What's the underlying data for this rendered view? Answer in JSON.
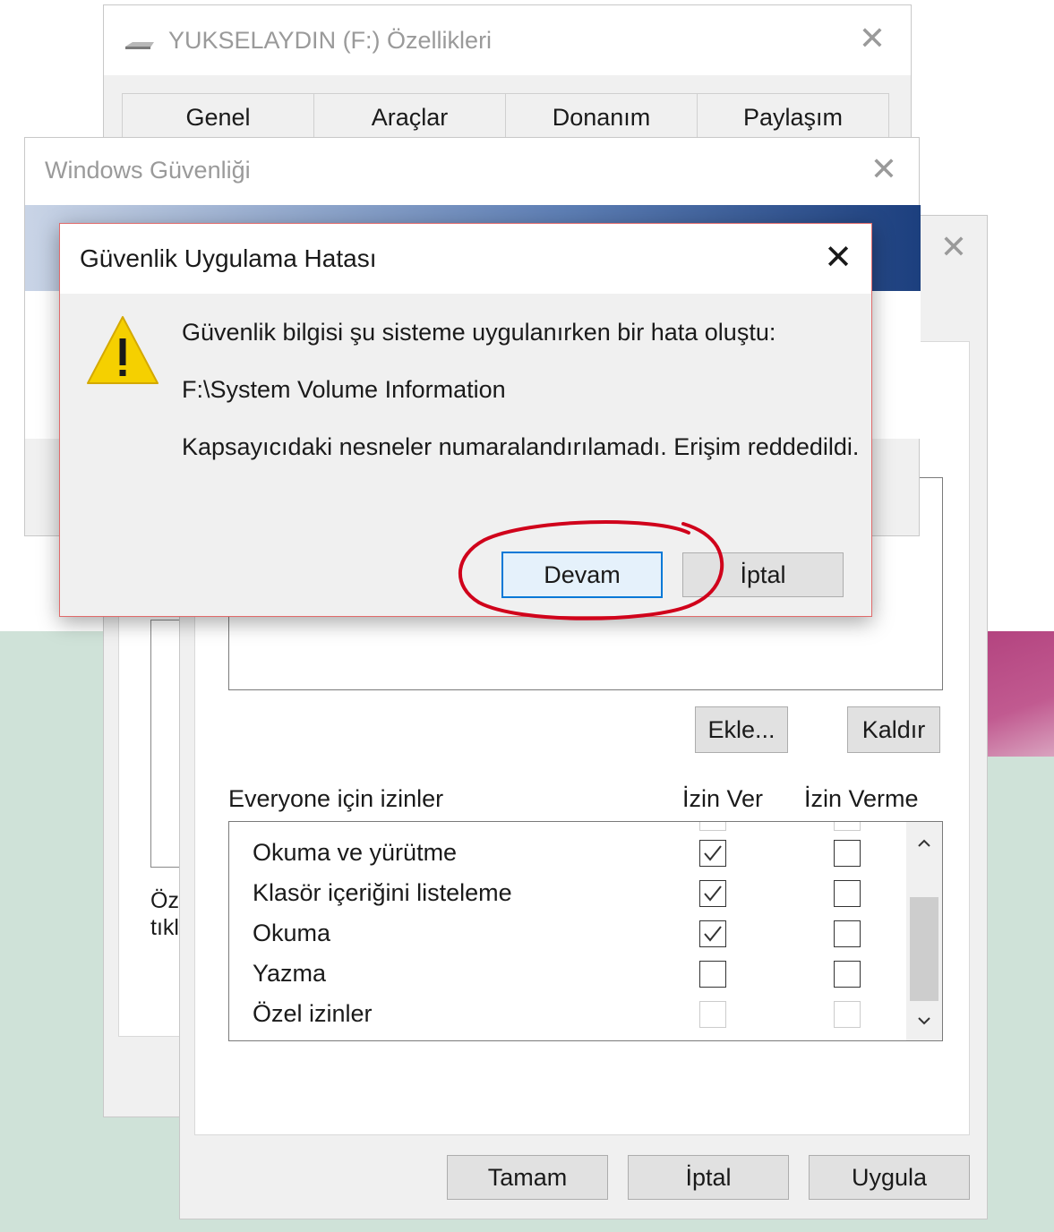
{
  "properties_window": {
    "title": "YUKSELAYDIN (F:) Özellikleri",
    "tabs": [
      "Genel",
      "Araçlar",
      "Donanım",
      "Paylaşım"
    ],
    "partial_text_line1": "Öz",
    "partial_text_line2": "tıkl"
  },
  "permissions_window": {
    "buttons": {
      "add": "Ekle...",
      "remove": "Kaldır",
      "ok": "Tamam",
      "cancel": "İptal",
      "apply": "Uygula"
    },
    "permissions_label": "Everyone için izinler",
    "allow_header": "İzin Ver",
    "deny_header": "İzin Verme",
    "permissions": [
      {
        "name": "Okuma ve yürütme",
        "allow": true,
        "deny": false,
        "disabled": false
      },
      {
        "name": "Klasör içeriğini listeleme",
        "allow": true,
        "deny": false,
        "disabled": false
      },
      {
        "name": "Okuma",
        "allow": true,
        "deny": false,
        "disabled": false
      },
      {
        "name": "Yazma",
        "allow": false,
        "deny": false,
        "disabled": false
      },
      {
        "name": "Özel izinler",
        "allow": false,
        "deny": false,
        "disabled": true
      }
    ]
  },
  "security_window": {
    "title": "Windows Güvenliği"
  },
  "error_dialog": {
    "title": "Güvenlik Uygulama Hatası",
    "message_line1": "Güvenlik bilgisi şu sisteme uygulanırken bir hata oluştu:",
    "message_line2": "F:\\System Volume Information",
    "message_line3": "Kapsayıcıdaki nesneler numaralandırılamadı. Erişim reddedildi.",
    "continue_label": "Devam",
    "cancel_label": "İptal"
  },
  "colors": {
    "highlight_circle": "#d0021b",
    "focus_border": "#0078d7",
    "warning_yellow": "#f5d000"
  }
}
